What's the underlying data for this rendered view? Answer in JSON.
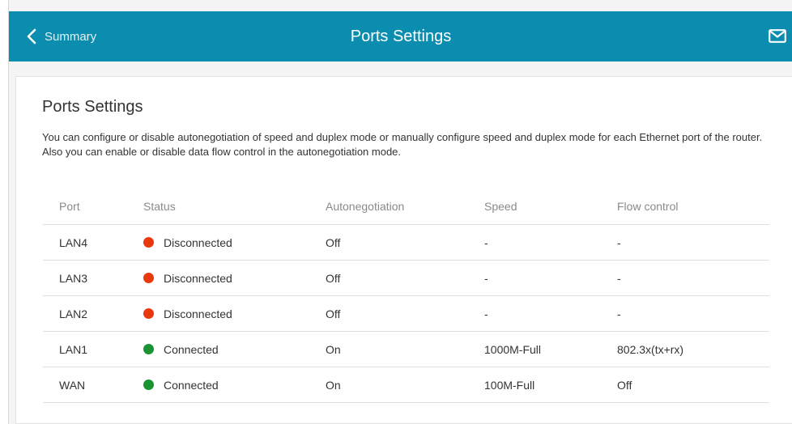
{
  "header": {
    "back_label": "Summary",
    "title": "Ports Settings",
    "back_icon": "chevron-left-icon",
    "mail_icon": "mail-icon"
  },
  "section": {
    "title": "Ports Settings",
    "description": "You can configure or disable autonegotiation of speed and duplex mode or manually configure speed and duplex mode for each Ethernet port of the router. Also you can enable or disable data flow control in the autonegotiation mode."
  },
  "table": {
    "columns": [
      "Port",
      "Status",
      "Autonegotiation",
      "Speed",
      "Flow control"
    ],
    "rows": [
      {
        "port": "LAN4",
        "status": "Disconnected",
        "state": "disconnected",
        "autonegotiation": "Off",
        "speed": "-",
        "flow_control": "-"
      },
      {
        "port": "LAN3",
        "status": "Disconnected",
        "state": "disconnected",
        "autonegotiation": "Off",
        "speed": "-",
        "flow_control": "-"
      },
      {
        "port": "LAN2",
        "status": "Disconnected",
        "state": "disconnected",
        "autonegotiation": "Off",
        "speed": "-",
        "flow_control": "-"
      },
      {
        "port": "LAN1",
        "status": "Connected",
        "state": "connected",
        "autonegotiation": "On",
        "speed": "1000M-Full",
        "flow_control": "802.3x(tx+rx)"
      },
      {
        "port": "WAN",
        "status": "Connected",
        "state": "connected",
        "autonegotiation": "On",
        "speed": "100M-Full",
        "flow_control": "Off"
      }
    ]
  },
  "colors": {
    "header_bg": "#0b8db0",
    "disconnected": "#e8380d",
    "connected": "#1a9332"
  }
}
